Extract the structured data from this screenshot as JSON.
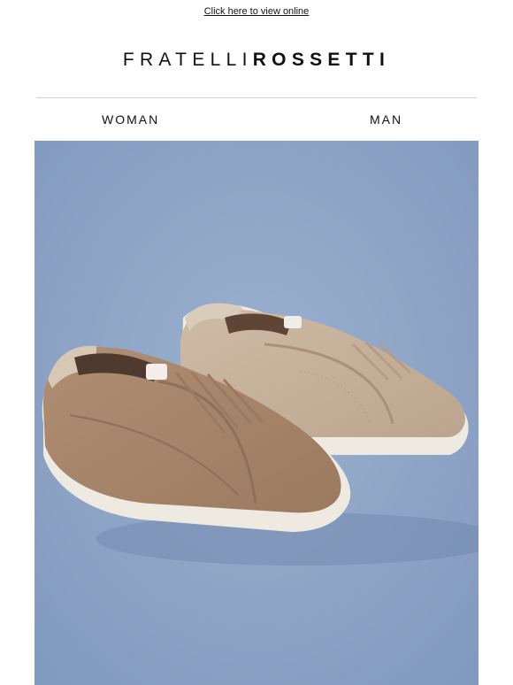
{
  "header": {
    "view_online_link": "Click here to view online"
  },
  "brand": {
    "name_light": "FRATELLI",
    "name_bold": "ROSSETTI"
  },
  "nav": {
    "items": [
      {
        "label": "WOMAN"
      },
      {
        "label": "MAN"
      }
    ]
  },
  "hero": {
    "image_subject": "two suede slip-on sneakers on blue background",
    "colors": {
      "background": "#8fa6c8",
      "shoe_dark": "#a9856a",
      "shoe_light": "#c8b39d",
      "sole": "#eeeae2"
    }
  }
}
